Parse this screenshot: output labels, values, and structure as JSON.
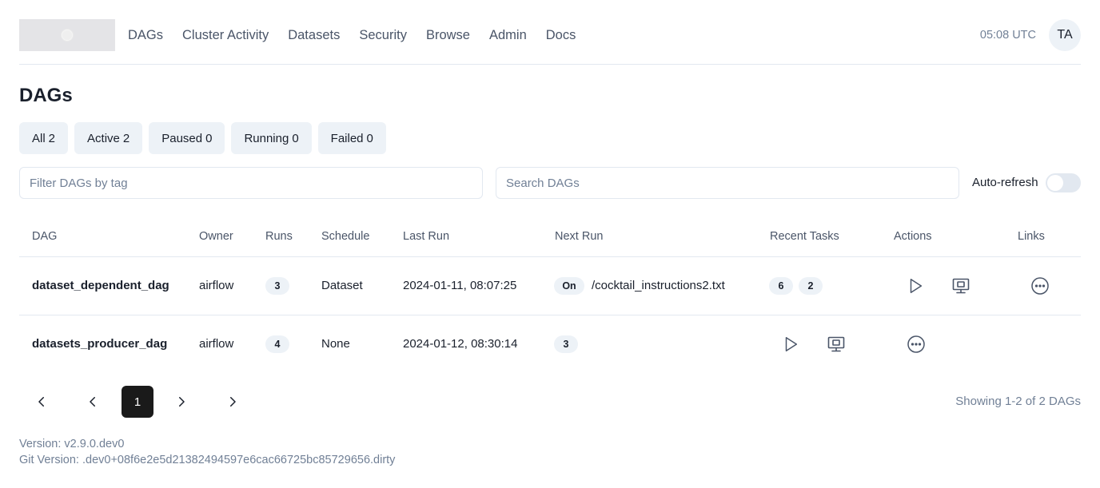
{
  "header": {
    "nav": [
      "DAGs",
      "Cluster Activity",
      "Datasets",
      "Security",
      "Browse",
      "Admin",
      "Docs"
    ],
    "clock": "05:08 UTC",
    "avatar_initials": "TA"
  },
  "page_title": "DAGs",
  "filters": [
    {
      "label": "All",
      "count": "2"
    },
    {
      "label": "Active",
      "count": "2"
    },
    {
      "label": "Paused",
      "count": "0"
    },
    {
      "label": "Running",
      "count": "0"
    },
    {
      "label": "Failed",
      "count": "0"
    }
  ],
  "tag_filter": {
    "placeholder": "Filter DAGs by tag",
    "value": ""
  },
  "search": {
    "placeholder": "Search DAGs",
    "value": ""
  },
  "auto_refresh": {
    "label": "Auto-refresh",
    "enabled": false
  },
  "table": {
    "columns": [
      "DAG",
      "Owner",
      "Runs",
      "Schedule",
      "Last Run",
      "Next Run",
      "Recent Tasks",
      "Actions",
      "Links"
    ],
    "rows": [
      {
        "dag": "dataset_dependent_dag",
        "owner": "airflow",
        "runs": "3",
        "schedule": "Dataset",
        "last_run": "2024-01-11, 08:07:25",
        "next_run_badge": "On",
        "next_run_text": "/cocktail_instructions2.txt",
        "recent_tasks": [
          "6",
          "2"
        ]
      },
      {
        "dag": "datasets_producer_dag",
        "owner": "airflow",
        "runs": "4",
        "schedule": "None",
        "last_run": "2024-01-12, 08:30:14",
        "recent_tasks": [
          "3"
        ]
      }
    ]
  },
  "pagination": {
    "current_page": "1",
    "summary": "Showing 1-2 of 2 DAGs"
  },
  "footer": {
    "version": "Version: v2.9.0.dev0",
    "git_version": "Git Version: .dev0+08f6e2e5d21382494597e6cac66725bc85729656.dirty"
  },
  "icons": {
    "trigger": "play-icon",
    "graph": "monitor-icon",
    "more": "more-horizontal-icon",
    "pagination": [
      "chevron-left-icon",
      "chevron-left-icon",
      "chevron-right-icon",
      "chevron-right-icon"
    ]
  },
  "colors": {
    "active_page": "#1a1a1a",
    "badge_bg": "#edf2f7",
    "muted_text": "#718096"
  }
}
